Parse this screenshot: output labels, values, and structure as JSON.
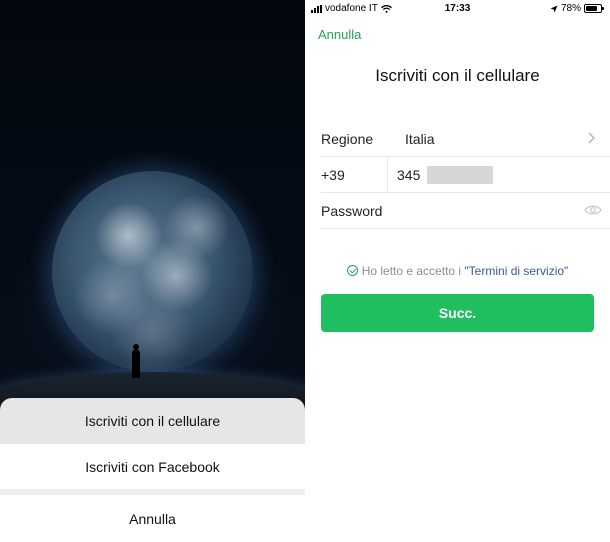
{
  "left_screen": {
    "action_sheet": {
      "items": [
        {
          "label": "Iscriviti con il cellulare"
        },
        {
          "label": "Iscriviti con Facebook"
        },
        {
          "label": "Annulla"
        }
      ]
    }
  },
  "right_screen": {
    "status_bar": {
      "carrier": "vodafone IT",
      "time": "17:33",
      "battery": "78%",
      "battery_level": 0.78
    },
    "cancel_label": "Annulla",
    "title": "Iscriviti con il cellulare",
    "form": {
      "region_label": "Regione",
      "region_value": "Italia",
      "country_code": "+39",
      "phone_value": "345",
      "password_label": "Password"
    },
    "terms": {
      "prefix": "Ho letto e accetto i",
      "link": "\"Termini di servizio\""
    },
    "submit_label": "Succ.",
    "accent_color": "#1fbf5f",
    "link_color": "#22a35a"
  }
}
